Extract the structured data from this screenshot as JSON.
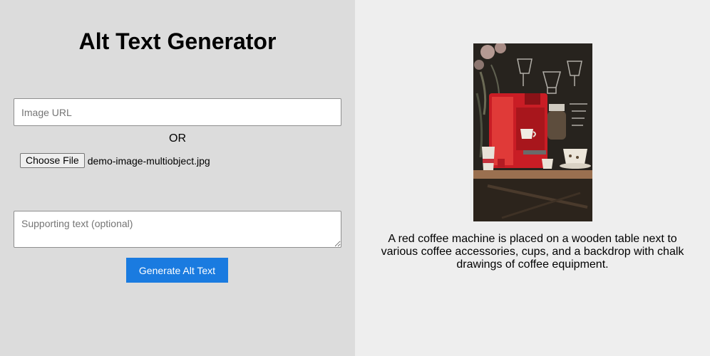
{
  "app": {
    "title": "Alt Text Generator"
  },
  "form": {
    "url_placeholder": "Image URL",
    "url_value": "",
    "or_label": "OR",
    "file_button_label": "Choose File",
    "file_name": "demo-image-multiobject.jpg",
    "support_placeholder": "Supporting text (optional)",
    "support_value": "",
    "generate_label": "Generate Alt Text"
  },
  "result": {
    "alt_text": "A red coffee machine is placed on a wooden table next to various coffee accessories, cups, and a backdrop with chalk drawings of coffee equipment."
  },
  "colors": {
    "left_bg": "#dcdcdc",
    "right_bg": "#eeeeee",
    "button_bg": "#1a7be0"
  }
}
